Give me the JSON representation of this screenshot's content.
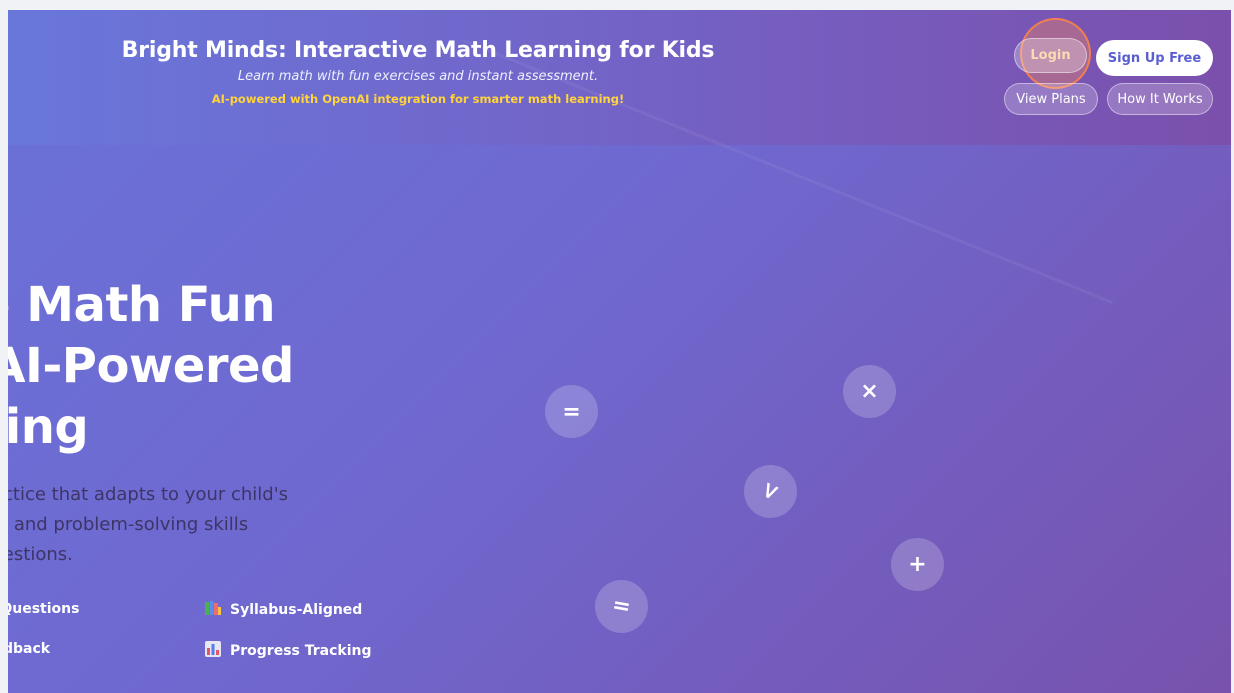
{
  "header": {
    "title": "Bright Minds: Interactive Math Learning for Kids",
    "tagline": "Learn math with fun exercises and instant assessment.",
    "ai_note": "AI-powered with OpenAI integration for smarter math learning!",
    "buttons": {
      "login": "Login",
      "signup": "Sign Up Free",
      "view_plans": "View Plans",
      "how_it_works": "How It Works"
    }
  },
  "hero": {
    "title_line1": "ake Math Fun",
    "title_line2": "th AI-Powered",
    "title_line3": "arning",
    "desc_line1": "ctive math practice that adapts to your child's",
    "desc_line2": "uild confidence and problem-solving skills",
    "desc_line3": "ersonalized questions."
  },
  "features": [
    {
      "icon": "ai-icon",
      "label": "owered Questions"
    },
    {
      "icon": "books-icon",
      "label": "Syllabus-Aligned"
    },
    {
      "icon": "lightning-icon",
      "label": "ant Feedback"
    },
    {
      "icon": "chart-icon",
      "label": "Progress Tracking"
    }
  ],
  "math_symbols": [
    {
      "name": "equals-bubble-upper",
      "symbol": "="
    },
    {
      "name": "multiply-bubble",
      "symbol": "×"
    },
    {
      "name": "less-than-bubble",
      "symbol": "<"
    },
    {
      "name": "plus-bubble",
      "symbol": "+"
    },
    {
      "name": "equals-bubble-lower",
      "symbol": "="
    }
  ],
  "colors": {
    "gradient_start": "#6a72d9",
    "gradient_end": "#7852ad",
    "accent_yellow": "#ffd43b",
    "signup_text": "#5a5fd0",
    "login_highlight": "#ff8446"
  }
}
